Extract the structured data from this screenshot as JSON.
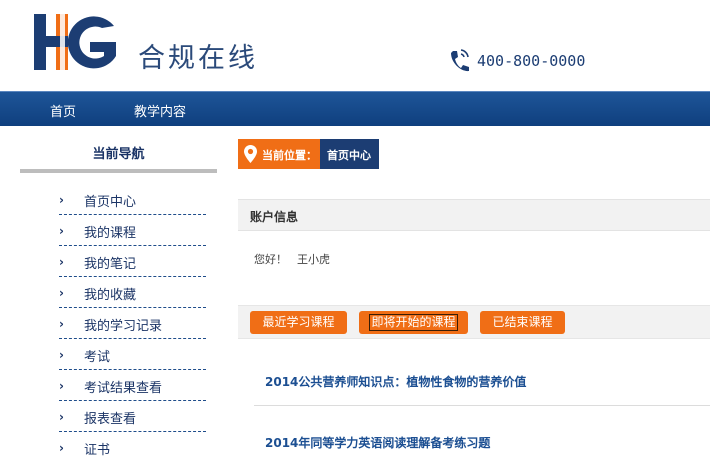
{
  "header": {
    "logo_text": "HG",
    "site_title": "合规在线",
    "phone": "400-800-0000"
  },
  "nav": {
    "items": [
      {
        "label": "首页"
      },
      {
        "label": "教学内容"
      }
    ]
  },
  "sidebar": {
    "title": "当前导航",
    "items": [
      {
        "label": "首页中心"
      },
      {
        "label": "我的课程"
      },
      {
        "label": "我的笔记"
      },
      {
        "label": "我的收藏"
      },
      {
        "label": "我的学习记录"
      },
      {
        "label": "考试"
      },
      {
        "label": "考试结果查看"
      },
      {
        "label": "报表查看"
      },
      {
        "label": "证书"
      }
    ],
    "chevron": "›"
  },
  "breadcrumb": {
    "label": "当前位置：",
    "current": "首页中心"
  },
  "account": {
    "heading": "账户信息",
    "greeting": "您好！",
    "user_name": "王小虎"
  },
  "tabs": [
    {
      "label": "最近学习课程"
    },
    {
      "label": "即将开始的课程"
    },
    {
      "label": "已结束课程"
    }
  ],
  "courses": [
    {
      "title": "2014公共营养师知识点：植物性食物的营养价值"
    },
    {
      "title": "2014年同等学力英语阅读理解备考练习题"
    }
  ],
  "colors": {
    "brand_blue": "#1c3d73",
    "nav_blue": "#1e5598",
    "accent_orange": "#f06e16",
    "link_blue": "#1c4f92"
  },
  "icons": {
    "logo": "hg-logo",
    "phone": "phone-icon",
    "location": "location-pin-icon",
    "chevron": "chevron-right-icon"
  }
}
